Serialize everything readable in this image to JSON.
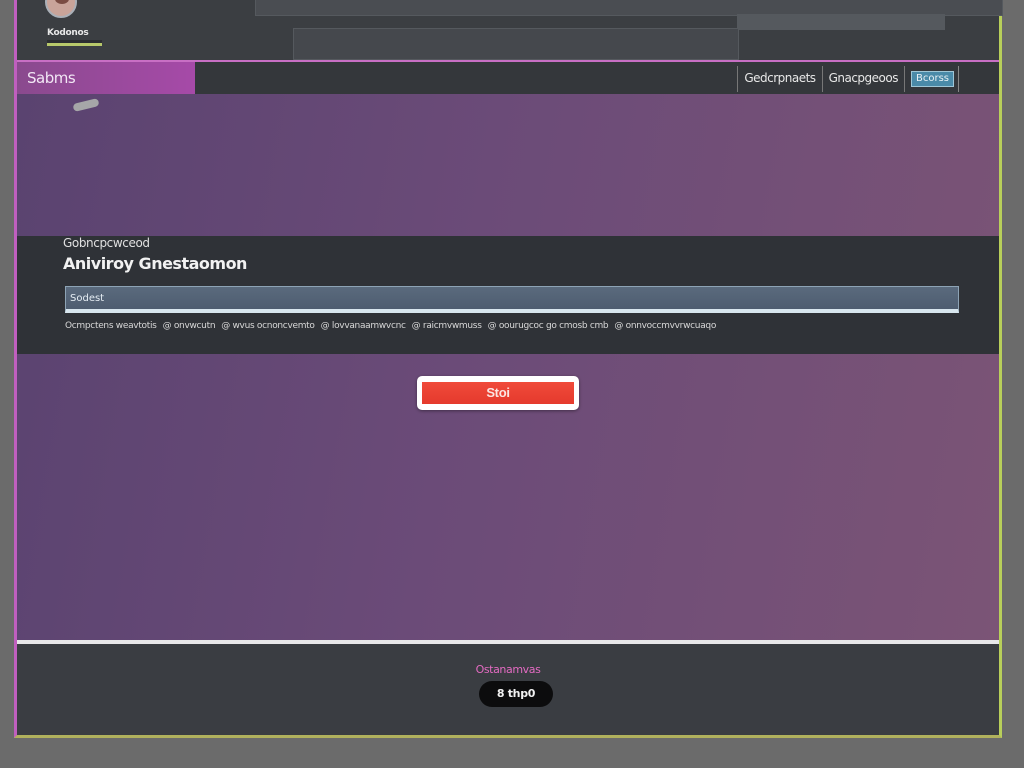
{
  "user": {
    "name": "Kodonos"
  },
  "nav": {
    "brand": "Sabms",
    "links": [
      "Gedcrpnaets",
      "Gnacpgeoos"
    ],
    "button": "Bcorss"
  },
  "panel": {
    "title": "Gobncpcwceod",
    "heading": "Aniviroy Gnestaomon",
    "search_placeholder": "Sodest",
    "filters": [
      "Ocmpctens weavtotis",
      "@ onvwcutn",
      "@ wvus ocnoncvemto",
      "@ lovvanaamwvcnc",
      "@ raicmvwmuss",
      "@ oourugcoc go cmosb cmb",
      "@ onnvoccmvvrwcuaqo"
    ]
  },
  "actions": {
    "start": "Stoi"
  },
  "footer": {
    "label": "Ostanamvas",
    "badge": "8 thp0"
  }
}
